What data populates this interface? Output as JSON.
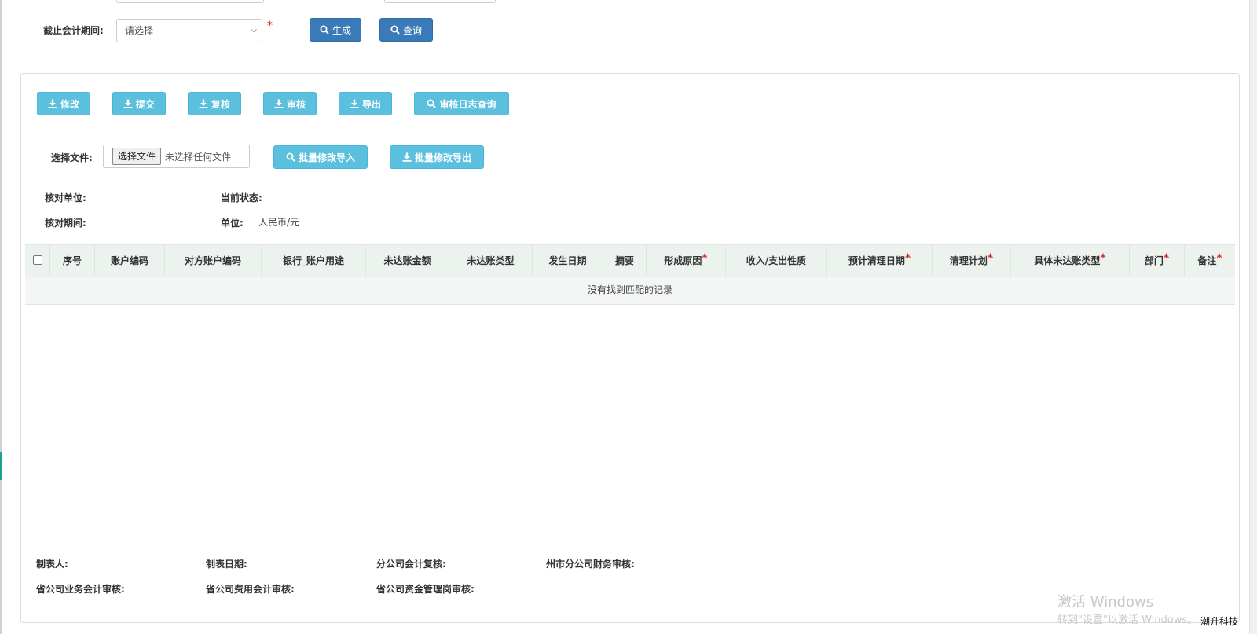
{
  "header": {
    "period_label": "截止会计期间:",
    "period_select": {
      "value": "请选择"
    },
    "required_mark": "*",
    "generate_label": "生成",
    "query_label": "查询"
  },
  "toolbar": {
    "buttons": [
      {
        "label": "修改",
        "icon": "download-icon"
      },
      {
        "label": "提交",
        "icon": "download-icon"
      },
      {
        "label": "复核",
        "icon": "download-icon"
      },
      {
        "label": "审核",
        "icon": "download-icon"
      },
      {
        "label": "导出",
        "icon": "download-icon"
      },
      {
        "label": "审核日志查询",
        "icon": "search-icon"
      }
    ]
  },
  "file": {
    "label": "选择文件:",
    "choose_button": "选择文件",
    "status": "未选择任何文件",
    "import_label": "批量修改导入",
    "export_label": "批量修改导出"
  },
  "info": {
    "unit_label": "核对单位:",
    "status_label": "当前状态:",
    "period_label": "核对期间:",
    "currency_label": "单位:",
    "currency_value": "人民币/元"
  },
  "table": {
    "columns": [
      {
        "label": "序号",
        "required": false
      },
      {
        "label": "账户编码",
        "required": false
      },
      {
        "label": "对方账户编码",
        "required": false
      },
      {
        "label": "银行_账户用途",
        "required": false
      },
      {
        "label": "未达账金额",
        "required": false
      },
      {
        "label": "未达账类型",
        "required": false
      },
      {
        "label": "发生日期",
        "required": false
      },
      {
        "label": "摘要",
        "required": false
      },
      {
        "label": "形成原因",
        "required": true
      },
      {
        "label": "收入/支出性质",
        "required": false
      },
      {
        "label": "预计清理日期",
        "required": true
      },
      {
        "label": "清理计划",
        "required": true
      },
      {
        "label": "具体未达账类型",
        "required": true
      },
      {
        "label": "部门",
        "required": true
      },
      {
        "label": "备注",
        "required": true
      }
    ],
    "empty_message": "没有找到匹配的记录"
  },
  "footer": {
    "preparer": "制表人:",
    "prepare_date": "制表日期:",
    "branch_review": "分公司会计复核:",
    "city_finance_review": "州市分公司财务审核:",
    "province_business_review": "省公司业务会计审核:",
    "province_expense_review": "省公司费用会计审核:",
    "province_fund_review": "省公司资金管理岗审核:"
  },
  "overlay": {
    "activate_title": "激活 Windows",
    "activate_hint": "转到\"设置\"以激活 Windows。",
    "brand": "潮升科技"
  },
  "colors": {
    "primary": "#3a7ab8",
    "info": "#5bc0de",
    "required": "#e02020",
    "table_header": "#ecf3ee"
  }
}
